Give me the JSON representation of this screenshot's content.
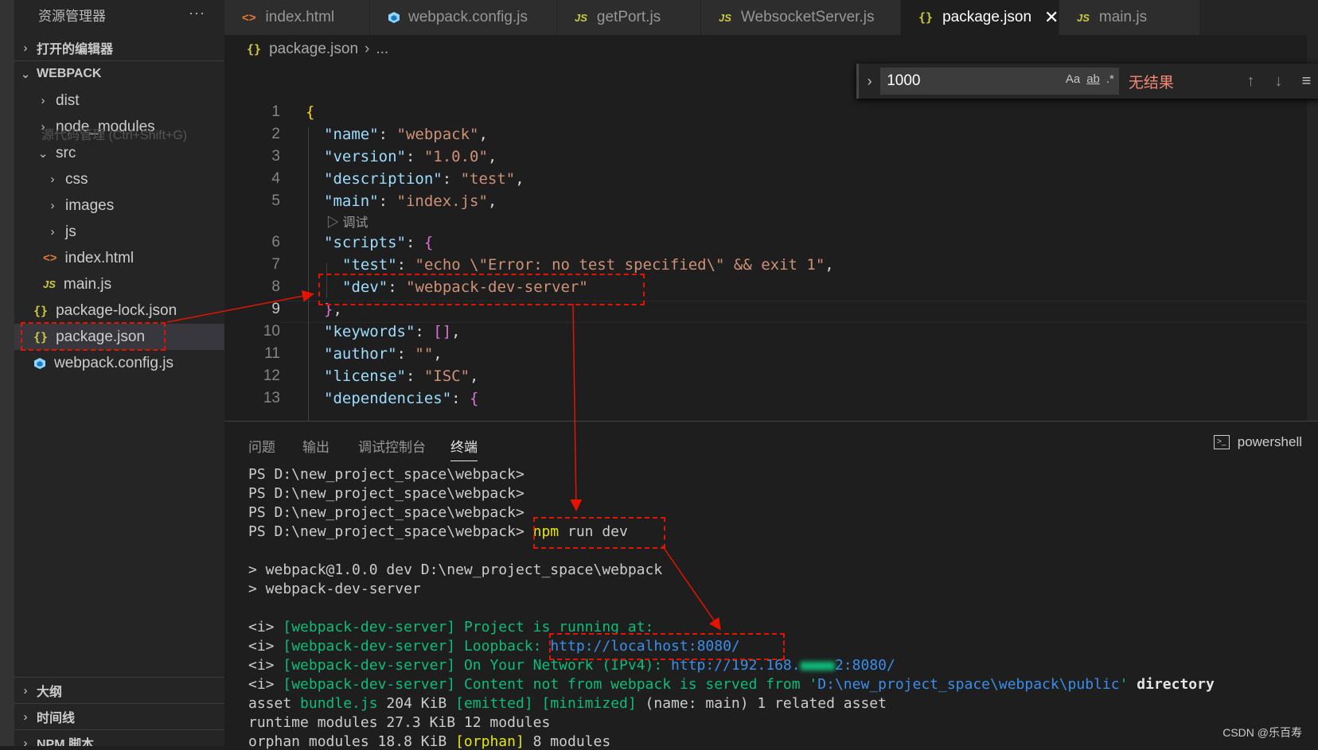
{
  "sidebar": {
    "title": "资源管理器",
    "more": "···",
    "open_editors": "打开的编辑器",
    "project": "WEBPACK",
    "tooltip": "源代码管理 (Ctrl+Shift+G)",
    "items": [
      {
        "label": "dist"
      },
      {
        "label": "node_modules"
      },
      {
        "label": "src"
      },
      {
        "label": "css"
      },
      {
        "label": "images"
      },
      {
        "label": "js"
      },
      {
        "label": "index.html"
      },
      {
        "label": "main.js"
      },
      {
        "label": "package-lock.json"
      },
      {
        "label": "package.json"
      },
      {
        "label": "webpack.config.js"
      }
    ],
    "outline": "大纲",
    "timeline": "时间线",
    "npm": "NPM 脚本"
  },
  "tabs": [
    {
      "label": "index.html"
    },
    {
      "label": "webpack.config.js"
    },
    {
      "label": "getPort.js"
    },
    {
      "label": "WebsocketServer.js"
    },
    {
      "label": "package.json",
      "close": "✕"
    },
    {
      "label": "main.js"
    }
  ],
  "icons": {
    "json": "{}",
    "js": "JS",
    "html": "<>"
  },
  "breadcrumb": {
    "file": "package.json",
    "rest": "..."
  },
  "find": {
    "value": "1000",
    "aa": "Aa",
    "ab": "ab",
    "regex": ".*",
    "no_results": "无结果"
  },
  "editor": {
    "line_numbers": [
      "1",
      "2",
      "3",
      "4",
      "5",
      "6",
      "7",
      "8",
      "9",
      "10",
      "11",
      "12",
      "13"
    ],
    "codelens": "▷ 调试",
    "tokens": {
      "open": "{",
      "colon": ": ",
      "comma": ",",
      "name_k": "\"name\"",
      "name_v": "\"webpack\"",
      "version_k": "\"version\"",
      "version_v": "\"1.0.0\"",
      "desc_k": "\"description\"",
      "desc_v": "\"test\"",
      "main_k": "\"main\"",
      "main_v": "\"index.js\"",
      "scripts_k": "\"scripts\"",
      "scripts_open": "{",
      "test_k": "\"test\"",
      "test_v": "\"echo \\\"Error: no test specified\\\" && exit 1\"",
      "dev_k": "\"dev\"",
      "dev_v": "\"webpack-dev-server\"",
      "scripts_close": "}",
      "keywords_k": "\"keywords\"",
      "keywords_v": "[]",
      "author_k": "\"author\"",
      "author_v": "\"\"",
      "license_k": "\"license\"",
      "license_v": "\"ISC\"",
      "deps_k": "\"dependencies\"",
      "deps_open": "{"
    }
  },
  "panel": {
    "tabs": [
      "问题",
      "输出",
      "调试控制台",
      "终端"
    ],
    "shell": "powershell",
    "shell_icon": ">_"
  },
  "terminal": {
    "prompt": "PS D:\\new_project_space\\webpack>",
    "cmd_npm": "npm",
    "cmd_rest": " run dev",
    "run1": "> webpack@1.0.0 dev D:\\new_project_space\\webpack",
    "run2": "> webpack-dev-server",
    "i": "<i>",
    "wds": "[webpack-dev-server]",
    "l1_text": "Project is running at:",
    "l2_text": "Loopback:",
    "l2_url": "http://localhost:8080/",
    "l3_text": "On Your Network (IPv4):",
    "l3_url_a": "http://192.168.",
    "l3_url_b": "2:8080/",
    "l4_text": "Content not from webpack is served from '",
    "l4_path": "D:\\new_project_space\\webpack\\public",
    "l4_end": "' ",
    "l4_dir": "directory",
    "asset_a": "asset ",
    "asset_b": "bundle.js",
    "asset_c": " 204 KiB ",
    "asset_d": "[emitted] [minimized]",
    "asset_e": " (name: main) 1 related asset",
    "runtime": "runtime modules 27.3 KiB 12 modules",
    "orphan_a": "orphan modules 18.8 KiB ",
    "orphan_b": "[orphan]",
    "orphan_c": " 8 modules"
  },
  "watermark": "CSDN @乐百寿"
}
